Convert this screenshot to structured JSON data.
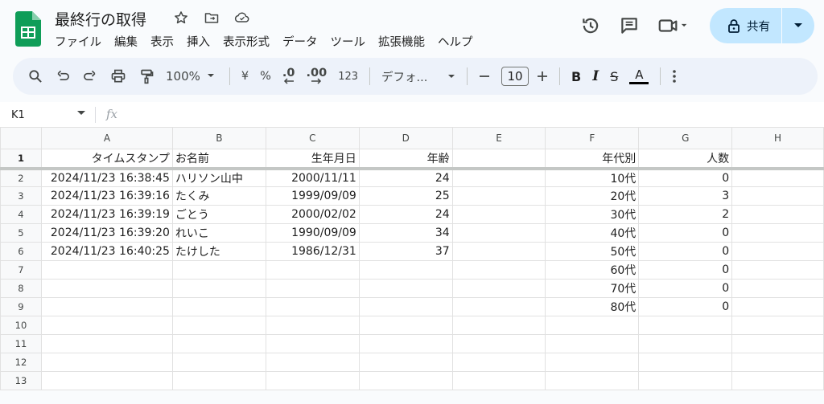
{
  "app": {
    "title": "最終行の取得"
  },
  "menu": [
    "ファイル",
    "編集",
    "表示",
    "挿入",
    "表示形式",
    "データ",
    "ツール",
    "拡張機能",
    "ヘルプ"
  ],
  "share": {
    "label": "共有"
  },
  "toolbar": {
    "zoom": "100%",
    "currency": "¥",
    "percent": "%",
    "dec_decrease": ".0",
    "dec_increase": ".00",
    "number_format": "123",
    "font": "デフォ...",
    "font_size": "10",
    "bold": "B",
    "italic": "I",
    "strike": "S",
    "text_color": "A"
  },
  "formula_bar": {
    "cell_ref": "K1",
    "fx": "fx"
  },
  "columns": [
    "A",
    "B",
    "C",
    "D",
    "E",
    "F",
    "G",
    "H"
  ],
  "rows": [
    {
      "n": "1",
      "a": "タイムスタンプ",
      "b": "お名前",
      "c": "生年月日",
      "d": "年齢",
      "e": "",
      "f": "年代別",
      "g": "人数",
      "h": ""
    },
    {
      "n": "2",
      "a": "2024/11/23 16:38:45",
      "b": "ハリソン山中",
      "c": "2000/11/11",
      "d": "24",
      "e": "",
      "f": "10代",
      "g": "0",
      "h": ""
    },
    {
      "n": "3",
      "a": "2024/11/23 16:39:16",
      "b": "たくみ",
      "c": "1999/09/09",
      "d": "25",
      "e": "",
      "f": "20代",
      "g": "3",
      "h": ""
    },
    {
      "n": "4",
      "a": "2024/11/23 16:39:19",
      "b": "ごとう",
      "c": "2000/02/02",
      "d": "24",
      "e": "",
      "f": "30代",
      "g": "2",
      "h": ""
    },
    {
      "n": "5",
      "a": "2024/11/23 16:39:20",
      "b": "れいこ",
      "c": "1990/09/09",
      "d": "34",
      "e": "",
      "f": "40代",
      "g": "0",
      "h": ""
    },
    {
      "n": "6",
      "a": "2024/11/23 16:40:25",
      "b": "たけした",
      "c": "1986/12/31",
      "d": "37",
      "e": "",
      "f": "50代",
      "g": "0",
      "h": ""
    },
    {
      "n": "7",
      "a": "",
      "b": "",
      "c": "",
      "d": "",
      "e": "",
      "f": "60代",
      "g": "0",
      "h": ""
    },
    {
      "n": "8",
      "a": "",
      "b": "",
      "c": "",
      "d": "",
      "e": "",
      "f": "70代",
      "g": "0",
      "h": ""
    },
    {
      "n": "9",
      "a": "",
      "b": "",
      "c": "",
      "d": "",
      "e": "",
      "f": "80代",
      "g": "0",
      "h": ""
    },
    {
      "n": "10",
      "a": "",
      "b": "",
      "c": "",
      "d": "",
      "e": "",
      "f": "",
      "g": "",
      "h": ""
    },
    {
      "n": "11",
      "a": "",
      "b": "",
      "c": "",
      "d": "",
      "e": "",
      "f": "",
      "g": "",
      "h": ""
    },
    {
      "n": "12",
      "a": "",
      "b": "",
      "c": "",
      "d": "",
      "e": "",
      "f": "",
      "g": "",
      "h": ""
    },
    {
      "n": "13",
      "a": "",
      "b": "",
      "c": "",
      "d": "",
      "e": "",
      "f": "",
      "g": "",
      "h": ""
    }
  ],
  "colors": {
    "accent": "#0b8043",
    "share_bg": "#c2e7ff",
    "toolbar_bg": "#edf2fa"
  }
}
